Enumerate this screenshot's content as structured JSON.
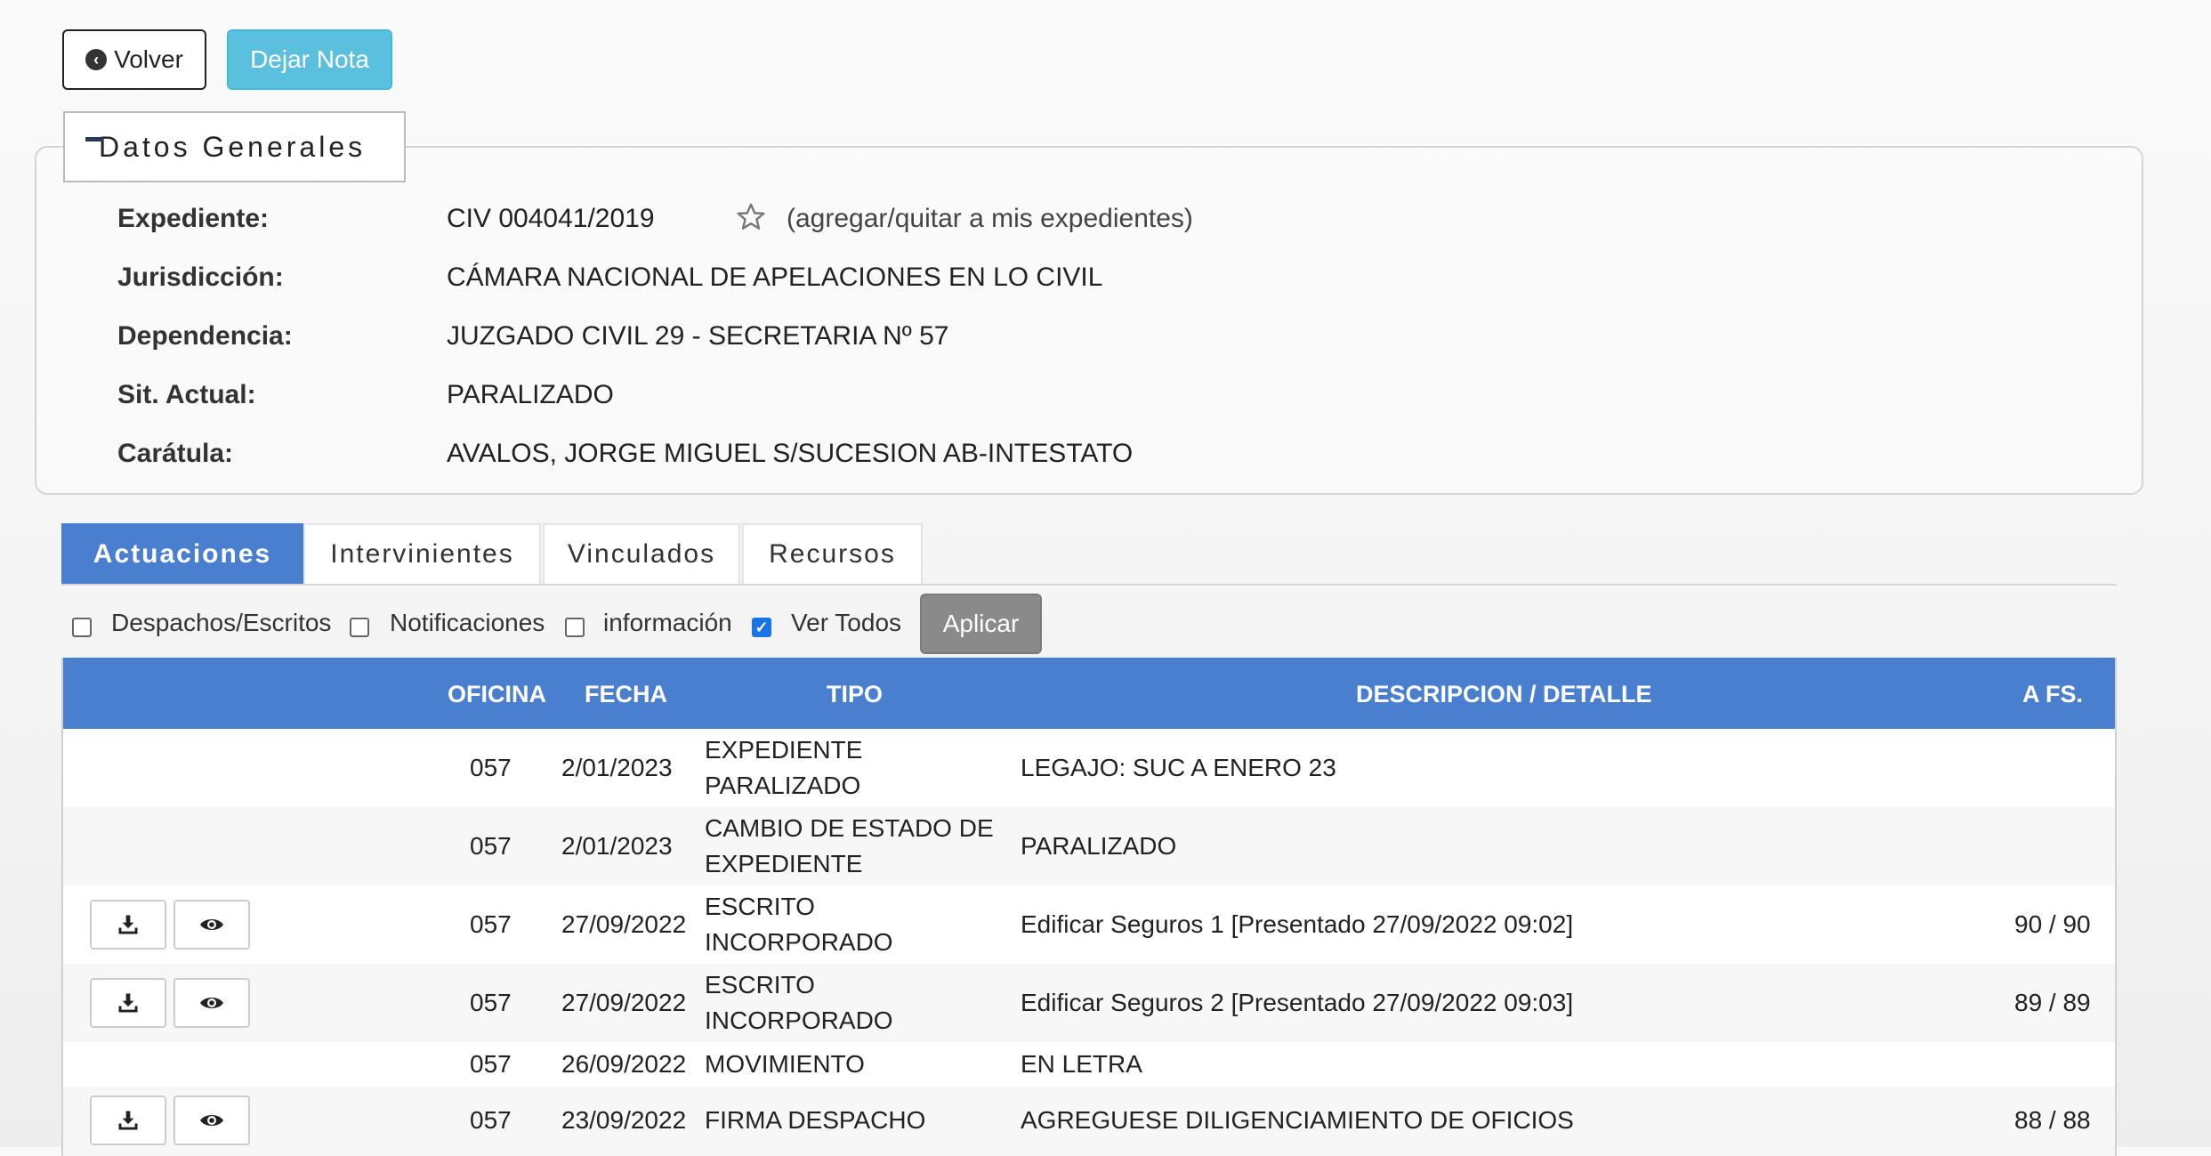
{
  "top_buttons": {
    "volver_label": "Volver",
    "nota_label": "Dejar Nota"
  },
  "datos_generales": {
    "legend": "Datos Generales",
    "fields": [
      {
        "label": "Expediente:",
        "value": "CIV 004041/2019"
      },
      {
        "label": "Jurisdicción:",
        "value": "CÁMARA NACIONAL DE APELACIONES EN LO CIVIL"
      },
      {
        "label": "Dependencia:",
        "value": "JUZGADO CIVIL 29 - SECRETARIA Nº 57"
      },
      {
        "label": "Sit. Actual:",
        "value": "PARALIZADO"
      },
      {
        "label": "Carátula:",
        "value": "AVALOS, JORGE MIGUEL S/SUCESION AB-INTESTATO"
      }
    ],
    "favorite_text": "(agregar/quitar a mis expedientes)"
  },
  "tabs": [
    {
      "label": "Actuaciones",
      "active": true
    },
    {
      "label": "Intervinientes",
      "active": false
    },
    {
      "label": "Vinculados",
      "active": false
    },
    {
      "label": "Recursos",
      "active": false
    }
  ],
  "filters": {
    "options": [
      {
        "label": "Despachos/Escritos",
        "checked": false
      },
      {
        "label": "Notificaciones",
        "checked": false
      },
      {
        "label": "información",
        "checked": false
      },
      {
        "label": "Ver Todos",
        "checked": true
      }
    ],
    "apply_label": "Aplicar"
  },
  "table": {
    "headers": {
      "oficina": "OFICINA",
      "fecha": "FECHA",
      "tipo": "TIPO",
      "descripcion": "DESCRIPCION / DETALLE",
      "afs": "A FS."
    },
    "rows": [
      {
        "oficina": "057",
        "fecha": "2/01/2023",
        "tipo1": "EXPEDIENTE",
        "tipo2": "PARALIZADO",
        "descripcion": "LEGAJO: SUC A ENERO 23",
        "afs": "",
        "actions": false
      },
      {
        "oficina": "057",
        "fecha": "2/01/2023",
        "tipo1": "CAMBIO DE ESTADO DE",
        "tipo2": "EXPEDIENTE",
        "descripcion": "PARALIZADO",
        "afs": "",
        "actions": false
      },
      {
        "oficina": "057",
        "fecha": "27/09/2022",
        "tipo1": "ESCRITO",
        "tipo2": "INCORPORADO",
        "descripcion": "Edificar Seguros 1 [Presentado 27/09/2022 09:02]",
        "afs": "90 / 90",
        "actions": true
      },
      {
        "oficina": "057",
        "fecha": "27/09/2022",
        "tipo1": "ESCRITO",
        "tipo2": "INCORPORADO",
        "descripcion": "Edificar Seguros 2 [Presentado 27/09/2022 09:03]",
        "afs": "89 / 89",
        "actions": true
      },
      {
        "oficina": "057",
        "fecha": "26/09/2022",
        "tipo1": "MOVIMIENTO",
        "tipo2": "",
        "descripcion": "EN LETRA",
        "afs": "",
        "actions": false
      },
      {
        "oficina": "057",
        "fecha": "23/09/2022",
        "tipo1": "FIRMA DESPACHO",
        "tipo2": "",
        "descripcion": "AGREGUESE DILIGENCIAMIENTO DE OFICIOS",
        "afs": "88 / 88",
        "actions": true
      }
    ]
  },
  "colors": {
    "primary": "#4a7fd0",
    "info": "#5bc0de",
    "apply": "#8a8a8a"
  },
  "icons": {
    "volver": "arrow-circle-left-icon",
    "favorite": "star-icon",
    "download": "download-icon",
    "view": "eye-icon",
    "collapse": "minus-icon"
  }
}
